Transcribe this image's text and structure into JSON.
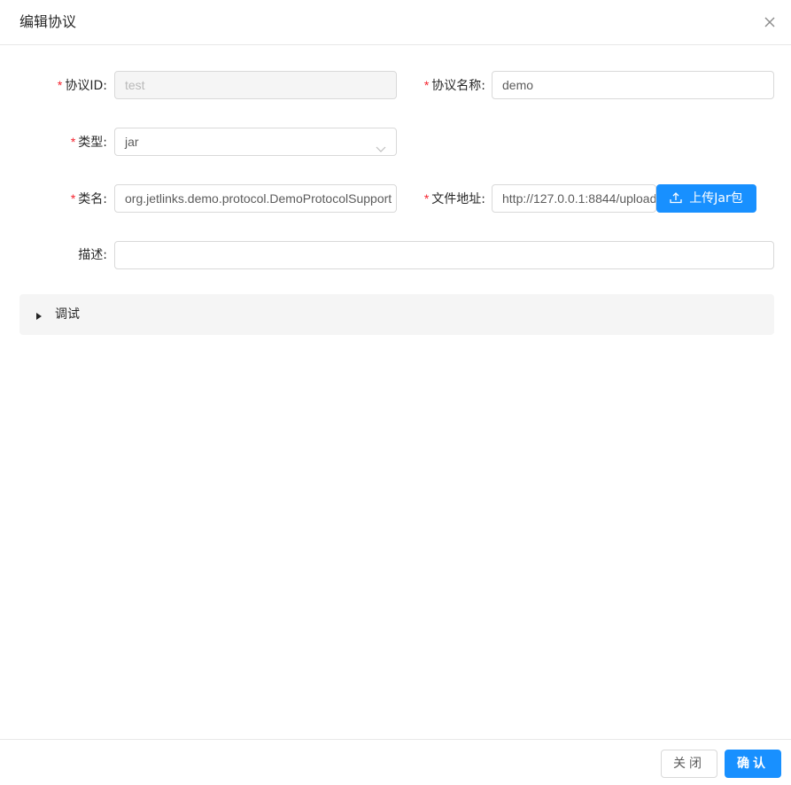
{
  "dialog": {
    "title": "编辑协议",
    "close_icon": "close-icon"
  },
  "form": {
    "protocol_id": {
      "label": "协议ID",
      "colon": ":",
      "value": "test",
      "required": true,
      "disabled": true
    },
    "protocol_name": {
      "label": "协议名称",
      "colon": ":",
      "value": "demo",
      "required": true
    },
    "type": {
      "label": "类型",
      "colon": ":",
      "value": "jar",
      "required": true,
      "icon": "chevron-down-icon"
    },
    "class_name": {
      "label": "类名",
      "colon": ":",
      "value": "org.jetlinks.demo.protocol.DemoProtocolSupport",
      "required": true
    },
    "file_address": {
      "label": "文件地址",
      "colon": ":",
      "value": "http://127.0.0.1:8844/upload",
      "required": true
    },
    "upload_button": {
      "label": "上传Jar包",
      "icon": "upload-icon"
    },
    "description": {
      "label": "描述",
      "colon": ":",
      "value": ""
    },
    "required_mark": "*"
  },
  "collapse": {
    "label": "调试",
    "icon": "caret-right-icon",
    "expanded": false
  },
  "footer": {
    "cancel_label": "关闭",
    "ok_label": "确认"
  },
  "colors": {
    "primary": "#1890ff",
    "required": "#f5222d",
    "border": "#d9d9d9",
    "collapse_bg": "#f5f5f5"
  }
}
